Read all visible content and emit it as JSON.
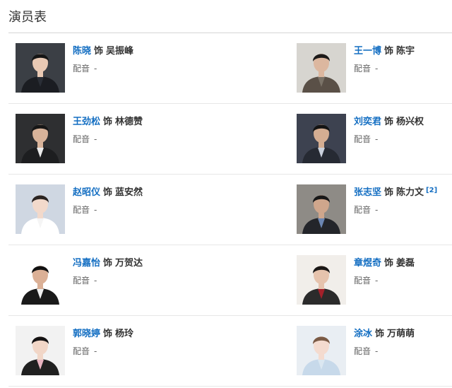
{
  "section": {
    "title": "演员表"
  },
  "labels": {
    "role_prefix": "饰",
    "dubbing_label": "配音",
    "dubbing_empty": "-"
  },
  "cast": [
    {
      "actor": "陈晓",
      "role": "吴振峰",
      "ref": "",
      "photo": {
        "bg": "#3b3f45",
        "skin": "#e9c9b4",
        "hair": "#151515",
        "suit": "#1b1d22",
        "shirt": "#2a2e36"
      }
    },
    {
      "actor": "王一博",
      "role": "陈宇",
      "ref": "",
      "photo": {
        "bg": "#d7d5d0",
        "skin": "#dcb79f",
        "hair": "#1c1a19",
        "suit": "#5a5047",
        "shirt": "#7b7368"
      }
    },
    {
      "actor": "王劲松",
      "role": "林德赞",
      "ref": "",
      "photo": {
        "bg": "#2e2f31",
        "skin": "#d8b39a",
        "hair": "#161616",
        "suit": "#1d1e20",
        "shirt": "#eaeaea"
      }
    },
    {
      "actor": "刘奕君",
      "role": "杨兴权",
      "ref": "",
      "photo": {
        "bg": "#3d4250",
        "skin": "#d4ad92",
        "hair": "#141414",
        "suit": "#262a33",
        "shirt": "#c9d0dc"
      }
    },
    {
      "actor": "赵昭仪",
      "role": "蓝安然",
      "ref": "",
      "photo": {
        "bg": "#cfd7e2",
        "skin": "#f2d9cb",
        "hair": "#2a2422",
        "suit": "#ffffff",
        "shirt": "#f5f5f5"
      }
    },
    {
      "actor": "张志坚",
      "role": "陈力文",
      "ref": "[2]",
      "photo": {
        "bg": "#8e8b86",
        "skin": "#cfa68c",
        "hair": "#181818",
        "suit": "#23252a",
        "shirt": "#6b86b3"
      }
    },
    {
      "actor": "冯嘉怡",
      "role": "万贺达",
      "ref": "",
      "photo": {
        "bg": "#ffffff",
        "skin": "#dbb096",
        "hair": "#111111",
        "suit": "#1a1a1a",
        "shirt": "#f0f0f0"
      }
    },
    {
      "actor": "章煜奇",
      "role": "姜磊",
      "ref": "",
      "photo": {
        "bg": "#f1eeea",
        "skin": "#e6c3ad",
        "hair": "#1a1716",
        "suit": "#2b2b2b",
        "shirt": "#a3202a"
      }
    },
    {
      "actor": "郭晓婷",
      "role": "杨玲",
      "ref": "",
      "photo": {
        "bg": "#f2f2f2",
        "skin": "#f1d6c7",
        "hair": "#141213",
        "suit": "#202020",
        "shirt": "#e9b4c0"
      }
    },
    {
      "actor": "涂冰",
      "role": "万萌萌",
      "ref": "",
      "photo": {
        "bg": "#e9eef3",
        "skin": "#f4dbcf",
        "hair": "#7a5a45",
        "suit": "#c7d9ea",
        "shirt": "#dbe7f1"
      }
    }
  ]
}
